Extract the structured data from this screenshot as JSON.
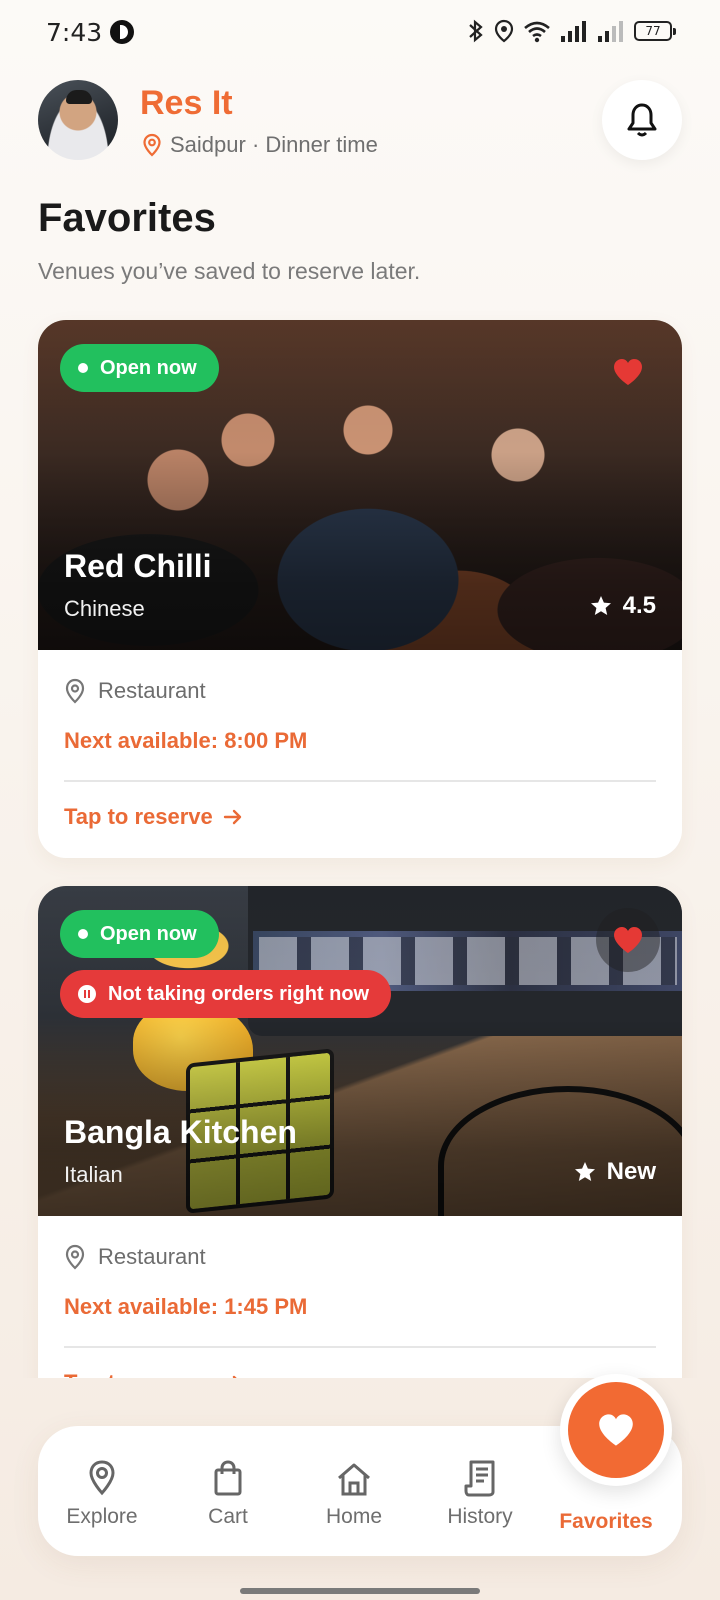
{
  "status_bar": {
    "time": "7:43",
    "battery": "77"
  },
  "header": {
    "app_title": "Res It",
    "location": "Saidpur · Dinner time"
  },
  "page": {
    "title": "Favorites",
    "subtitle": "Venues you’ve saved to reserve later."
  },
  "venues": [
    {
      "name": "Red Chilli",
      "cuisine": "Chinese",
      "open_badge": "Open now",
      "rating": "4.5",
      "type": "Restaurant",
      "next_available": "Next available: 8:00 PM",
      "reserve_label": "Tap to reserve"
    },
    {
      "name": "Bangla Kitchen",
      "cuisine": "Italian",
      "open_badge": "Open now",
      "status_badge": "Not taking orders right now",
      "rating": "New",
      "type": "Restaurant",
      "next_available": "Next available: 1:45 PM",
      "reserve_label": "Tap to reserve"
    }
  ],
  "nav": {
    "items": [
      {
        "label": "Explore",
        "icon": "map-pin-icon"
      },
      {
        "label": "Cart",
        "icon": "shopping-bag-icon"
      },
      {
        "label": "Home",
        "icon": "home-icon"
      },
      {
        "label": "History",
        "icon": "receipt-icon"
      },
      {
        "label": "Favorites",
        "icon": "heart-icon"
      }
    ],
    "active": "Favorites"
  },
  "colors": {
    "accent": "#ef6c35",
    "open_green": "#22c05e",
    "closed_red": "#e53a3a"
  }
}
